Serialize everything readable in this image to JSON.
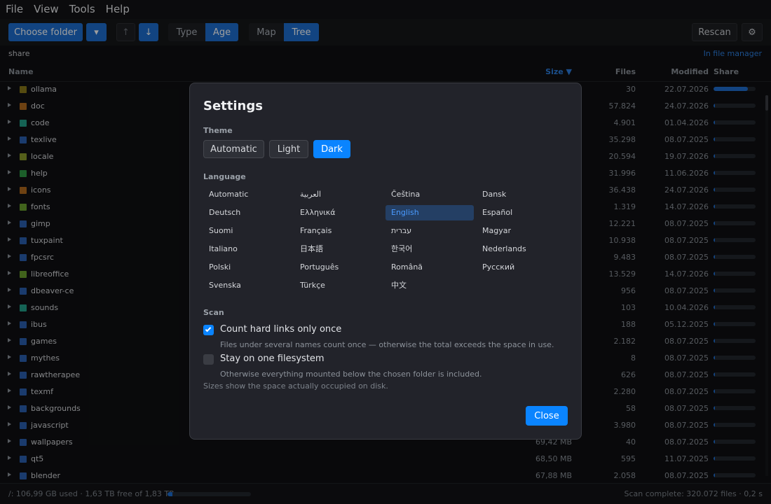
{
  "menu": [
    "File",
    "View",
    "Tools",
    "Help"
  ],
  "toolbar": {
    "choose_folder": "Choose folder",
    "dropdown_glyph": "▾",
    "sort_asc_glyph": "↑",
    "sort_desc_glyph": "↓",
    "color_by": [
      "Type",
      "Age"
    ],
    "color_by_active": "Age",
    "view_mode": [
      "Map",
      "Tree"
    ],
    "view_mode_active": "Tree",
    "rescan": "Rescan",
    "settings_glyph": "⚙"
  },
  "breadcrumb": "share",
  "open_in_file_manager": "In file manager",
  "columns": {
    "name": "Name",
    "size": "Size ▼",
    "files": "Files",
    "modified": "Modified",
    "share": "Share"
  },
  "rows": [
    {
      "name": "ollama",
      "size": "",
      "files": "30",
      "modified": "22.07.2026",
      "share": 0.82,
      "color": "#8a7a1a"
    },
    {
      "name": "doc",
      "size": "",
      "files": "57.824",
      "modified": "24.07.2026",
      "share": 0.03,
      "color": "#b06a1e"
    },
    {
      "name": "code",
      "size": "",
      "files": "4.901",
      "modified": "01.04.2026",
      "share": 0.03,
      "color": "#23a08a"
    },
    {
      "name": "texlive",
      "size": "",
      "files": "35.298",
      "modified": "08.07.2025",
      "share": 0.03,
      "color": "#2a5fb0"
    },
    {
      "name": "locale",
      "size": "",
      "files": "20.594",
      "modified": "19.07.2026",
      "share": 0.03,
      "color": "#8a9a2a"
    },
    {
      "name": "help",
      "size": "",
      "files": "31.996",
      "modified": "11.06.2026",
      "share": 0.02,
      "color": "#2e9a44"
    },
    {
      "name": "icons",
      "size": "",
      "files": "36.438",
      "modified": "24.07.2026",
      "share": 0.02,
      "color": "#b06a1e"
    },
    {
      "name": "fonts",
      "size": "",
      "files": "1.319",
      "modified": "14.07.2026",
      "share": 0.02,
      "color": "#6aa12e"
    },
    {
      "name": "gimp",
      "size": "",
      "files": "12.221",
      "modified": "08.07.2025",
      "share": 0.02,
      "color": "#2a5fb0"
    },
    {
      "name": "tuxpaint",
      "size": "",
      "files": "10.938",
      "modified": "08.07.2025",
      "share": 0.02,
      "color": "#2a5fb0"
    },
    {
      "name": "fpcsrc",
      "size": "",
      "files": "9.483",
      "modified": "08.07.2025",
      "share": 0.02,
      "color": "#2a5fb0"
    },
    {
      "name": "libreoffice",
      "size": "",
      "files": "13.529",
      "modified": "14.07.2026",
      "share": 0.02,
      "color": "#6aa12e"
    },
    {
      "name": "dbeaver-ce",
      "size": "",
      "files": "956",
      "modified": "08.07.2025",
      "share": 0.02,
      "color": "#2a5fb0"
    },
    {
      "name": "sounds",
      "size": "",
      "files": "103",
      "modified": "10.04.2026",
      "share": 0.02,
      "color": "#23a08a"
    },
    {
      "name": "ibus",
      "size": "",
      "files": "188",
      "modified": "05.12.2025",
      "share": 0.02,
      "color": "#2a5fb0"
    },
    {
      "name": "games",
      "size": "",
      "files": "2.182",
      "modified": "08.07.2025",
      "share": 0.02,
      "color": "#2a5fb0"
    },
    {
      "name": "mythes",
      "size": "",
      "files": "8",
      "modified": "08.07.2025",
      "share": 0.02,
      "color": "#2a5fb0"
    },
    {
      "name": "rawtherapee",
      "size": "",
      "files": "626",
      "modified": "08.07.2025",
      "share": 0.02,
      "color": "#2a5fb0"
    },
    {
      "name": "texmf",
      "size": "",
      "files": "2.280",
      "modified": "08.07.2025",
      "share": 0.02,
      "color": "#2a5fb0"
    },
    {
      "name": "backgrounds",
      "size": "",
      "files": "58",
      "modified": "08.07.2025",
      "share": 0.02,
      "color": "#2a5fb0"
    },
    {
      "name": "javascript",
      "size": "",
      "files": "3.980",
      "modified": "08.07.2025",
      "share": 0.02,
      "color": "#2a5fb0"
    },
    {
      "name": "wallpapers",
      "size": "69,42 MB",
      "files": "40",
      "modified": "08.07.2025",
      "share": 0.02,
      "color": "#2a5fb0"
    },
    {
      "name": "qt5",
      "size": "68,50 MB",
      "files": "595",
      "modified": "11.07.2025",
      "share": 0.02,
      "color": "#2a5fb0"
    },
    {
      "name": "blender",
      "size": "67,88 MB",
      "files": "2.058",
      "modified": "08.07.2025",
      "share": 0.02,
      "color": "#2a5fb0"
    }
  ],
  "status": {
    "disk": "/: 106,99 GB used · 1,63 TB free of 1,83 TB",
    "disk_fraction": 0.06,
    "scan": "Scan complete: 320.072 files · 0,2 s"
  },
  "settings": {
    "title": "Settings",
    "theme_label": "Theme",
    "themes": [
      "Automatic",
      "Light",
      "Dark"
    ],
    "theme_active": "Dark",
    "language_label": "Language",
    "languages": [
      "Automatic",
      "العربية",
      "Čeština",
      "Dansk",
      "Deutsch",
      "Ελληνικά",
      "English",
      "Español",
      "Suomi",
      "Français",
      "עברית",
      "Magyar",
      "Italiano",
      "日本語",
      "한국어",
      "Nederlands",
      "Polski",
      "Português",
      "Română",
      "Русский",
      "Svenska",
      "Türkçe",
      "中文"
    ],
    "language_active": "English",
    "scan_label": "Scan",
    "hardlinks_label": "Count hard links only once",
    "hardlinks_checked": true,
    "hardlinks_desc": "Files under several names count once — otherwise the total exceeds the space in use.",
    "onefs_label": "Stay on one filesystem",
    "onefs_checked": false,
    "onefs_desc": "Otherwise everything mounted below the chosen folder is included.",
    "note": "Sizes show the space actually occupied on disk.",
    "close": "Close"
  }
}
